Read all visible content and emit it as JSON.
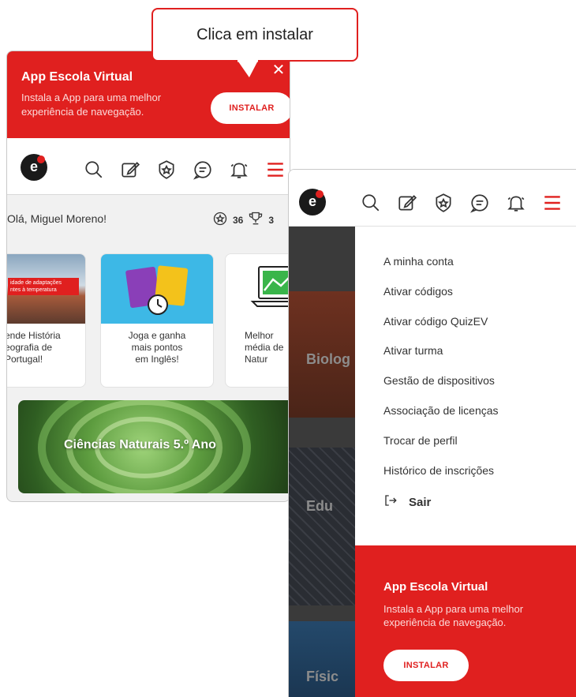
{
  "callout": {
    "text": "Clica em instalar"
  },
  "banner": {
    "title": "App Escola Virtual",
    "description": "Instala a App para uma melhor experiência de navegação.",
    "install_label": "INSTALAR",
    "close_symbol": "✕"
  },
  "header": {
    "logo_letter": "e",
    "icons": [
      "search-icon",
      "edit-icon",
      "badge-icon",
      "chat-icon",
      "bell-icon",
      "menu-icon"
    ],
    "accent_color": "#e0201f"
  },
  "greeting": {
    "text": "Olá, Miguel Moreno!",
    "badges_count": "36",
    "trophies_count": "3"
  },
  "cards": [
    {
      "caption": "ende História\neografia de\nPortugal!",
      "tag": "idade de adaptações\nntes à temperatura"
    },
    {
      "caption": "Joga e ganha\nmais pontos\nem Inglês!"
    },
    {
      "caption": "Melhor\nmédia de\nNatur"
    }
  ],
  "hero": {
    "title": "Ciências Naturais 5.º Ano"
  },
  "background_tiles": [
    "Biolog",
    "Edu",
    "Físic"
  ],
  "menu": {
    "items": [
      "A minha conta",
      "Ativar códigos",
      "Ativar código QuizEV",
      "Ativar turma",
      "Gestão de dispositivos",
      "Associação de licenças",
      "Trocar de perfil",
      "Histórico de inscrições"
    ],
    "logout_label": "Sair"
  },
  "banner_bottom": {
    "title": "App Escola Virtual",
    "description": "Instala a App para uma melhor experiência de navegação.",
    "install_label": "INSTALAR"
  }
}
